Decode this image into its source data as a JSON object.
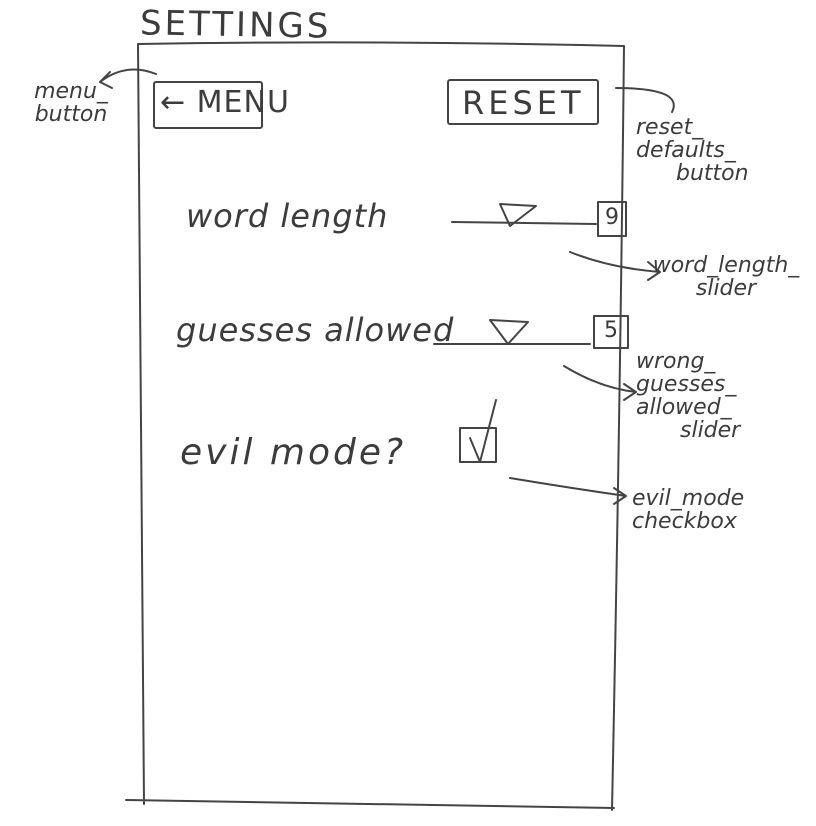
{
  "screen": {
    "title": "SETTINGS"
  },
  "menu_button": {
    "label": "← MENU"
  },
  "reset_button": {
    "label": "RESET"
  },
  "word_length": {
    "label": "word length",
    "value": "9"
  },
  "guesses_allowed": {
    "label": "guesses allowed",
    "value": "5"
  },
  "evil_mode": {
    "label": "evil mode?",
    "checked": true
  },
  "annotations": {
    "menu_button": [
      "menu_",
      "button"
    ],
    "reset_defaults_button": [
      "reset_",
      "defaults_",
      "button"
    ],
    "word_length_slider": [
      "word_length_",
      "slider"
    ],
    "wrong_guesses_allowed_slider": [
      "wrong_",
      "guesses_",
      "allowed_",
      "slider"
    ],
    "evil_mode_checkbox": [
      "evil_mode",
      "checkbox"
    ]
  },
  "colors": {
    "ink": "#3c3c3c",
    "paper": "#ffffff"
  }
}
